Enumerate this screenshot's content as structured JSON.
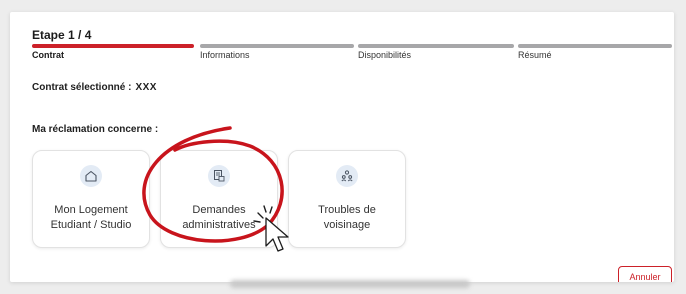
{
  "header": {
    "step_title": "Etape 1 / 4"
  },
  "stepper": {
    "steps": [
      {
        "label": "Contrat",
        "active": true
      },
      {
        "label": "Informations",
        "active": false
      },
      {
        "label": "Disponibilités",
        "active": false
      },
      {
        "label": "Résumé",
        "active": false
      }
    ]
  },
  "contract": {
    "label": "Contrat sélectionné :",
    "value": "XXX"
  },
  "claim": {
    "label": "Ma réclamation concerne :",
    "options": [
      {
        "line1": "Mon Logement",
        "line2": "Etudiant / Studio",
        "icon": "house-icon"
      },
      {
        "line1": "Demandes",
        "line2": "administratives",
        "icon": "document-icon"
      },
      {
        "line1": "Troubles de",
        "line2": "voisinage",
        "icon": "people-icon"
      }
    ]
  },
  "actions": {
    "cancel_label": "Annuler"
  },
  "colors": {
    "accent": "#cc2129",
    "inactive_step": "#a7a7a9",
    "icon_bg": "#e3ebf5",
    "icon_stroke": "#4b5563"
  }
}
